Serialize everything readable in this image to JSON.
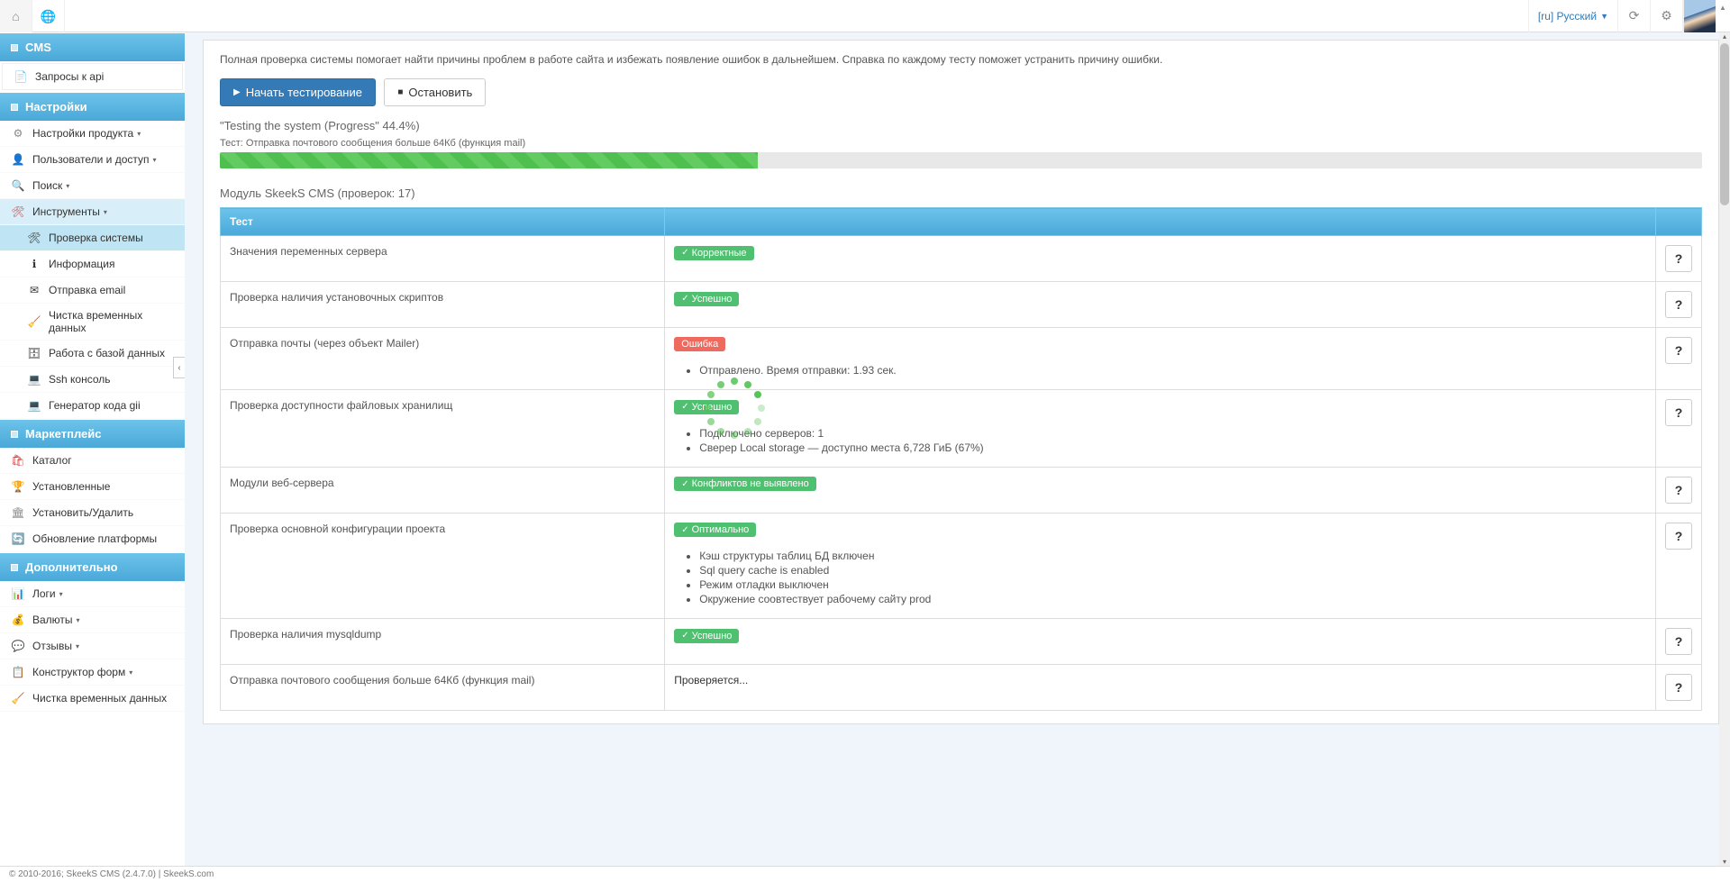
{
  "topbar": {
    "lang": "[ru] Русский"
  },
  "sidebar": {
    "groups": [
      {
        "title": "CMS",
        "items": [
          {
            "label": "Запросы к api",
            "icon": "📄",
            "whitebg": true
          }
        ]
      },
      {
        "title": "Настройки",
        "items": [
          {
            "label": "Настройки продукта",
            "icon": "⚙",
            "iconColor": "#888",
            "caret": true
          },
          {
            "label": "Пользователи и доступ",
            "icon": "👤",
            "caret": true
          },
          {
            "label": "Поиск",
            "icon": "🔍",
            "iconColor": "#2a8",
            "caret": true
          },
          {
            "label": "Инструменты",
            "icon": "🛠",
            "iconColor": "#b55",
            "caret": true,
            "parentActive": true,
            "children": [
              {
                "label": "Проверка системы",
                "icon": "🛠",
                "active": true
              },
              {
                "label": "Информация",
                "icon": "ℹ"
              },
              {
                "label": "Отправка email",
                "icon": "✉"
              },
              {
                "label": "Чистка временных данных",
                "icon": "🧹"
              },
              {
                "label": "Работа с базой данных",
                "icon": "🗄"
              },
              {
                "label": "Ssh консоль",
                "icon": "💻"
              },
              {
                "label": "Генератор кода gii",
                "icon": "💻"
              }
            ]
          }
        ]
      },
      {
        "title": "Маркетплейс",
        "items": [
          {
            "label": "Каталог",
            "icon": "🛍",
            "iconColor": "#d33"
          },
          {
            "label": "Установленные",
            "icon": "🏆",
            "iconColor": "#c93"
          },
          {
            "label": "Установить/Удалить",
            "icon": "🏛",
            "iconColor": "#888"
          },
          {
            "label": "Обновление платформы",
            "icon": "🔄",
            "iconColor": "#2a8"
          }
        ]
      },
      {
        "title": "Дополнительно",
        "items": [
          {
            "label": "Логи",
            "icon": "📊",
            "caret": true
          },
          {
            "label": "Валюты",
            "icon": "💰",
            "iconColor": "#c93",
            "caret": true
          },
          {
            "label": "Отзывы",
            "icon": "💬",
            "caret": true
          },
          {
            "label": "Конструктор форм",
            "icon": "📋",
            "caret": true
          },
          {
            "label": "Чистка временных данных",
            "icon": "🧹"
          }
        ]
      }
    ]
  },
  "main": {
    "description": "Полная проверка системы помогает найти причины проблем в работе сайта и избежать появление ошибок в дальнейшем. Справка по каждому тесту поможет устранить причину ошибки.",
    "start_btn": "Начать тестирование",
    "stop_btn": "Остановить",
    "progress_title": "\"Testing the system (Progress\" 44.4%)",
    "progress_sub": "Тест: Отправка почтового сообщения больше 64Кб (функция mail)",
    "progress_pct": 36.3,
    "module_title": "Модуль SkeekS CMS (проверок: 17)",
    "table_header": "Тест",
    "tests": [
      {
        "name": "Значения переменных сервера",
        "status": "Корректные",
        "kind": "ok",
        "help": true
      },
      {
        "name": "Проверка наличия установочных скриптов",
        "status": "Успешно",
        "kind": "ok",
        "help": true
      },
      {
        "name": "Отправка почты (через объект Mailer)",
        "status": "Ошибка",
        "kind": "err",
        "help": true,
        "details": [
          "Отправлено. Время отправки: 1.93 сек."
        ]
      },
      {
        "name": "Проверка доступности файловых хранилищ",
        "status": "Успешно",
        "kind": "ok",
        "help": true,
        "details": [
          "Подключено серверов: 1",
          "Сверер Local storage — доступно места 6,728 ГиБ (67%)"
        ]
      },
      {
        "name": "Модули веб-сервера",
        "status": "Конфликтов не выявлено",
        "kind": "ok",
        "help": true
      },
      {
        "name": "Проверка основной конфигурации проекта",
        "status": "Оптимально",
        "kind": "ok",
        "help": true,
        "details": [
          "Кэш структуры таблиц БД включен",
          "Sql query cache is enabled",
          "Режим отладки выключен",
          "Окружение соовтествует рабочему сайту prod"
        ]
      },
      {
        "name": "Проверка наличия mysqldump",
        "status": "Успешно",
        "kind": "ok",
        "help": true
      },
      {
        "name": "Отправка почтового сообщения больше 64Кб (функция mail)",
        "status_text": "Проверяется...",
        "help": true
      }
    ]
  },
  "footer": {
    "text": "© 2010-2016; SkeekS CMS (2.4.7.0) | SkeekS.com"
  }
}
